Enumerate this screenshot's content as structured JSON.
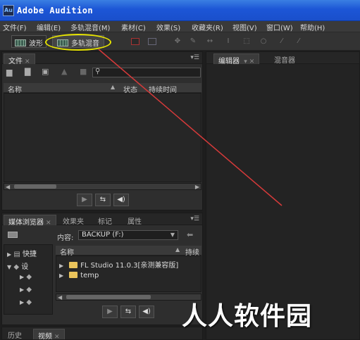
{
  "app": {
    "title": "Adobe Audition",
    "icon_label": "Au"
  },
  "menu": [
    "文件(F)",
    "编辑(E)",
    "多轨混音(M)",
    "素材(C)",
    "效果(S)",
    "收藏夹(R)",
    "视图(V)",
    "窗口(W)",
    "帮助(H)"
  ],
  "toolbar": {
    "waveform_label": "波形",
    "multitrack_label": "多轨混音"
  },
  "files_panel": {
    "tab": "文件",
    "columns": {
      "name": "名称",
      "status": "状态",
      "duration": "持续时间"
    }
  },
  "editor": {
    "tab_editor": "编辑器",
    "tab_mixer": "混音器"
  },
  "media_browser": {
    "tabs": [
      "媒体浏览器",
      "效果夹",
      "标记",
      "属性"
    ],
    "content_label": "内容:",
    "content_value": "BACKUP (F:)",
    "tree": [
      "快捷",
      "设",
      "",
      "",
      ""
    ],
    "columns": {
      "name": "名称",
      "duration": "持续"
    },
    "items": [
      "FL Studio 11.0.3[亲测兼容版]",
      "temp"
    ]
  },
  "bottom_tabs": [
    "历史",
    "视频"
  ],
  "watermark": "人人软件园",
  "colors": {
    "accent_highlight": "#e6e300",
    "annotation_line": "#d63a3a",
    "folder": "#e9c35b",
    "titlebar": "#1c56d6"
  }
}
